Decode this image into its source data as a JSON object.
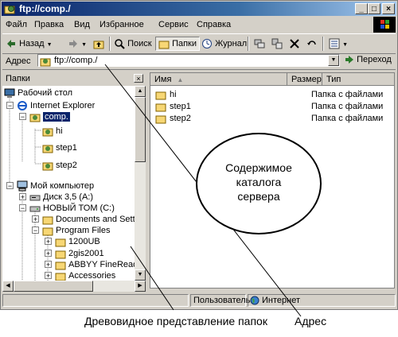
{
  "window": {
    "title": "ftp://comp./",
    "minimize": "_",
    "maximize": "□",
    "close": "×"
  },
  "menu": [
    "Файл",
    "Правка",
    "Вид",
    "Избранное",
    "Сервис",
    "Справка"
  ],
  "toolbar": {
    "back_label": "Назад",
    "search_label": "Поиск",
    "folders_label": "Папки",
    "history_label": "Журнал"
  },
  "address": {
    "label": "Адрес",
    "value": "ftp://comp./",
    "go_label": "Переход"
  },
  "tree": {
    "header": "Папки",
    "close": "×",
    "items": [
      {
        "label": "Рабочий стол"
      },
      {
        "label": "Internet Explorer"
      },
      {
        "label": "comp."
      },
      {
        "label": "hi"
      },
      {
        "label": "step1"
      },
      {
        "label": "step2"
      },
      {
        "label": "Мой компьютер"
      },
      {
        "label": "Диск 3,5 (A:)"
      },
      {
        "label": "НОВЫЙ ТОМ (C:)"
      },
      {
        "label": "Documents and Settin"
      },
      {
        "label": "Program Files"
      },
      {
        "label": "1200UB"
      },
      {
        "label": "2gis2001"
      },
      {
        "label": "ABBYY FineReader"
      },
      {
        "label": "Accessories"
      }
    ]
  },
  "list": {
    "columns": {
      "name": "Имя",
      "size": "Размер",
      "type": "Тип"
    },
    "rows": [
      {
        "name": "hi",
        "type": "Папка с файлами"
      },
      {
        "name": "step1",
        "type": "Папка с файлами"
      },
      {
        "name": "step2",
        "type": "Папка с файлами"
      }
    ]
  },
  "status": {
    "user": "Пользователь",
    "zone": "Интернет"
  },
  "annotations": {
    "callout_lines": [
      "Содержимое",
      "каталога",
      "сервера"
    ],
    "tree_caption": "Древовидное представление папок",
    "address_caption": "Адрес"
  },
  "colors": {
    "title_start": "#0a246a",
    "title_end": "#a6caf0",
    "folder": "#f7d775",
    "selected": "#0a246a"
  }
}
